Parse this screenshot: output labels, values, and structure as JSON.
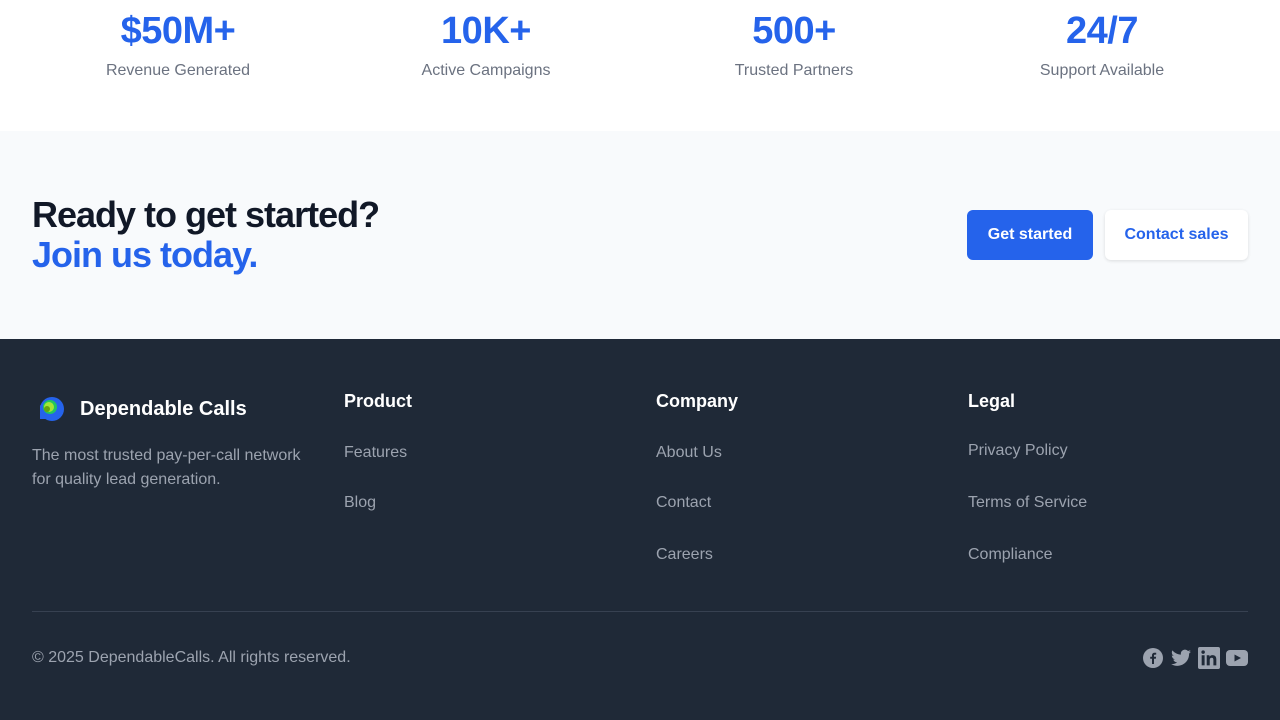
{
  "stats": [
    {
      "value": "$50M+",
      "label": "Revenue Generated"
    },
    {
      "value": "10K+",
      "label": "Active Campaigns"
    },
    {
      "value": "500+",
      "label": "Trusted Partners"
    },
    {
      "value": "24/7",
      "label": "Support Available"
    }
  ],
  "cta": {
    "line1": "Ready to get started?",
    "line2": "Join us today.",
    "primary_button": "Get started",
    "secondary_button": "Contact sales"
  },
  "footer": {
    "brand_name": "Dependable Calls",
    "brand_description": "The most trusted pay-per-call network for quality lead generation.",
    "columns": [
      {
        "title": "Product",
        "links": [
          "Features",
          "Blog"
        ]
      },
      {
        "title": "Company",
        "links": [
          "About Us",
          "Contact",
          "Careers"
        ]
      },
      {
        "title": "Legal",
        "links": [
          "Privacy Policy",
          "Terms of Service",
          "Compliance"
        ]
      }
    ],
    "copyright": "© 2025 DependableCalls. All rights reserved.",
    "socials": [
      "facebook-icon",
      "twitter-icon",
      "linkedin-icon",
      "youtube-icon"
    ]
  },
  "colors": {
    "accent": "#2563eb",
    "footer_bg": "#1f2937",
    "cta_bg": "#f8fafc"
  }
}
